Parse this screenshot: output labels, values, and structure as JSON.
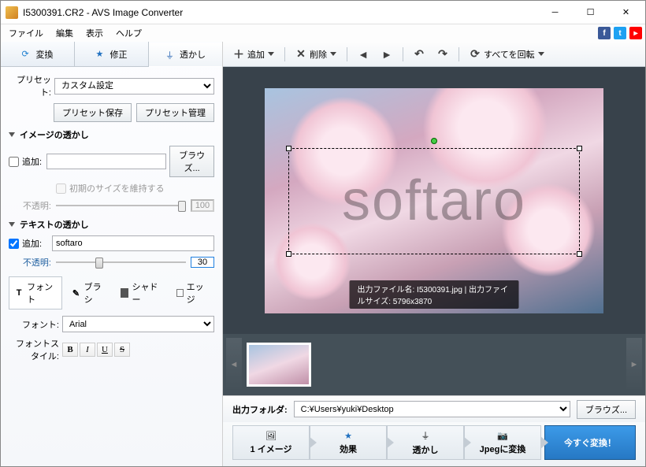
{
  "window": {
    "title": "I5300391.CR2 - AVS Image Converter"
  },
  "menu": {
    "file": "ファイル",
    "edit": "編集",
    "view": "表示",
    "help": "ヘルプ"
  },
  "left_tabs": {
    "convert": "変換",
    "correct": "修正",
    "watermark": "透かし"
  },
  "preset": {
    "label": "プリセット:",
    "value": "カスタム設定",
    "save": "プリセット保存",
    "manage": "プリセット管理"
  },
  "image_wm": {
    "heading": "イメージの透かし",
    "add": "追加:",
    "browse": "ブラウズ...",
    "keep_size": "初期のサイズを維持する",
    "opacity_label": "不透明:",
    "opacity_value": "100"
  },
  "text_wm": {
    "heading": "テキストの透かし",
    "add": "追加:",
    "text_value": "softaro",
    "opacity_label": "不透明:",
    "opacity_value": "30",
    "font_tab": "フォント",
    "brush_tab": "ブラシ",
    "shadow_tab": "シャドー",
    "edge_tab": "エッジ",
    "font_label": "フォント:",
    "font_value": "Arial",
    "style_label": "フォントスタイル:"
  },
  "toolbar": {
    "add": "追加",
    "delete": "削除",
    "rotate_all": "すべてを回転"
  },
  "preview": {
    "watermark_text": "softaro",
    "info": "出力ファイル名: I5300391.jpg | 出力ファイルサイズ: 5796x3870"
  },
  "output": {
    "label": "出力フォルダ:",
    "path": "C:¥Users¥yuki¥Desktop",
    "browse": "ブラウズ..."
  },
  "steps": {
    "image": "1 イメージ",
    "effect": "効果",
    "watermark": "透かし",
    "format": "Jpegに変換",
    "convert": "今すぐ変換！"
  }
}
